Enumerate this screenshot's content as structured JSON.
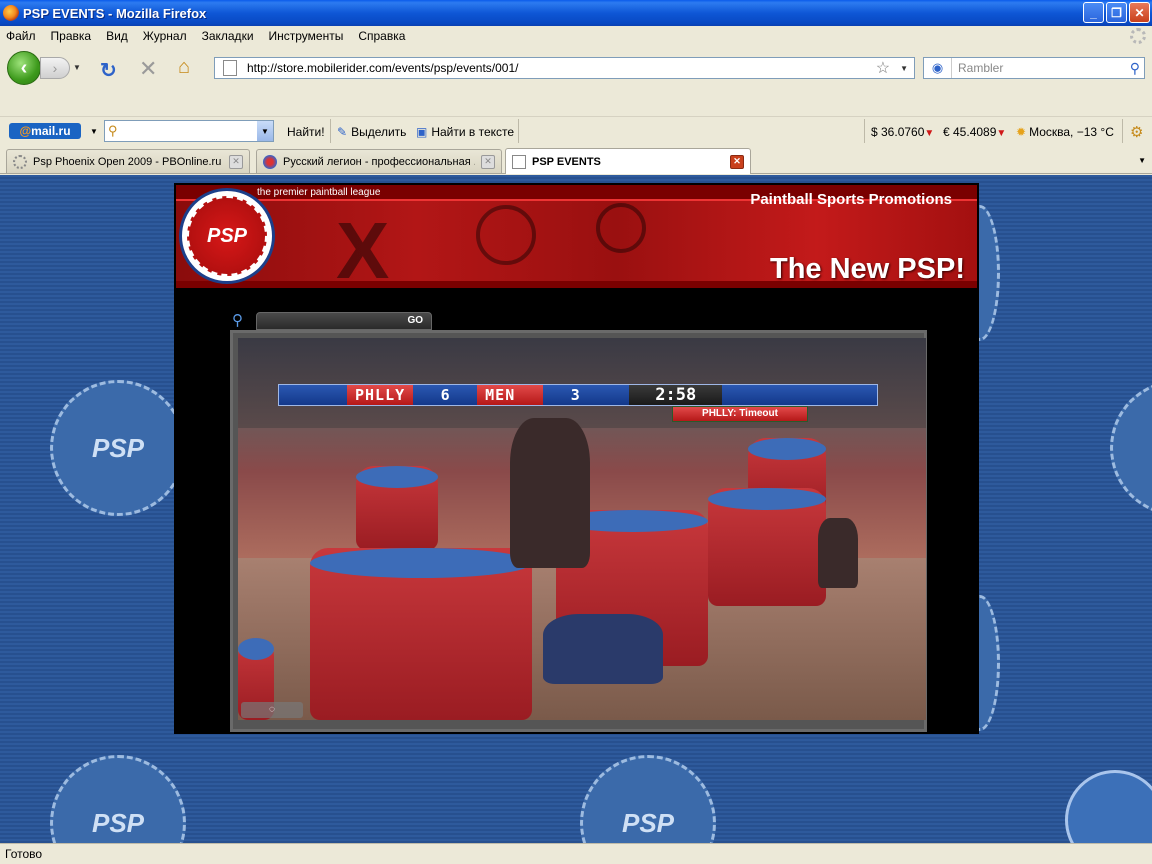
{
  "window": {
    "title": "PSP EVENTS - Mozilla Firefox",
    "minimize": "_",
    "maximize": "❐",
    "close": "✕"
  },
  "menu": [
    "Файл",
    "Правка",
    "Вид",
    "Журнал",
    "Закладки",
    "Инструменты",
    "Справка"
  ],
  "nav": {
    "url": "http://store.mobilerider.com/events/psp/events/001/",
    "search_placeholder": "Rambler"
  },
  "mailru": {
    "logo_at": "@",
    "logo_text": "mail.ru",
    "find": "Найти!",
    "highlight": "Выделить",
    "find_in_text": "Найти в тексте",
    "usd": "$ 36.0760",
    "eur": "€ 45.4089",
    "weather": "Москва, −13 °C"
  },
  "tabs": [
    {
      "label": "Psp Phoenix Open 2009 - PBOnline.ru -...",
      "active": false
    },
    {
      "label": "Русский легион - профессиональная ...",
      "active": false
    },
    {
      "label": "PSP EVENTS",
      "active": true
    }
  ],
  "site": {
    "tagline": "the premier paintball league",
    "org": "Paintball Sports Promotions",
    "slogan": "The New PSP!",
    "seal_text": "PSP",
    "search_go": "GO"
  },
  "video": {
    "team1": "PHLLY",
    "score1": "6",
    "team2": "MEN",
    "score2": "3",
    "clock": "2:58",
    "status": "PHLLY: Timeout"
  },
  "status": "Готово"
}
